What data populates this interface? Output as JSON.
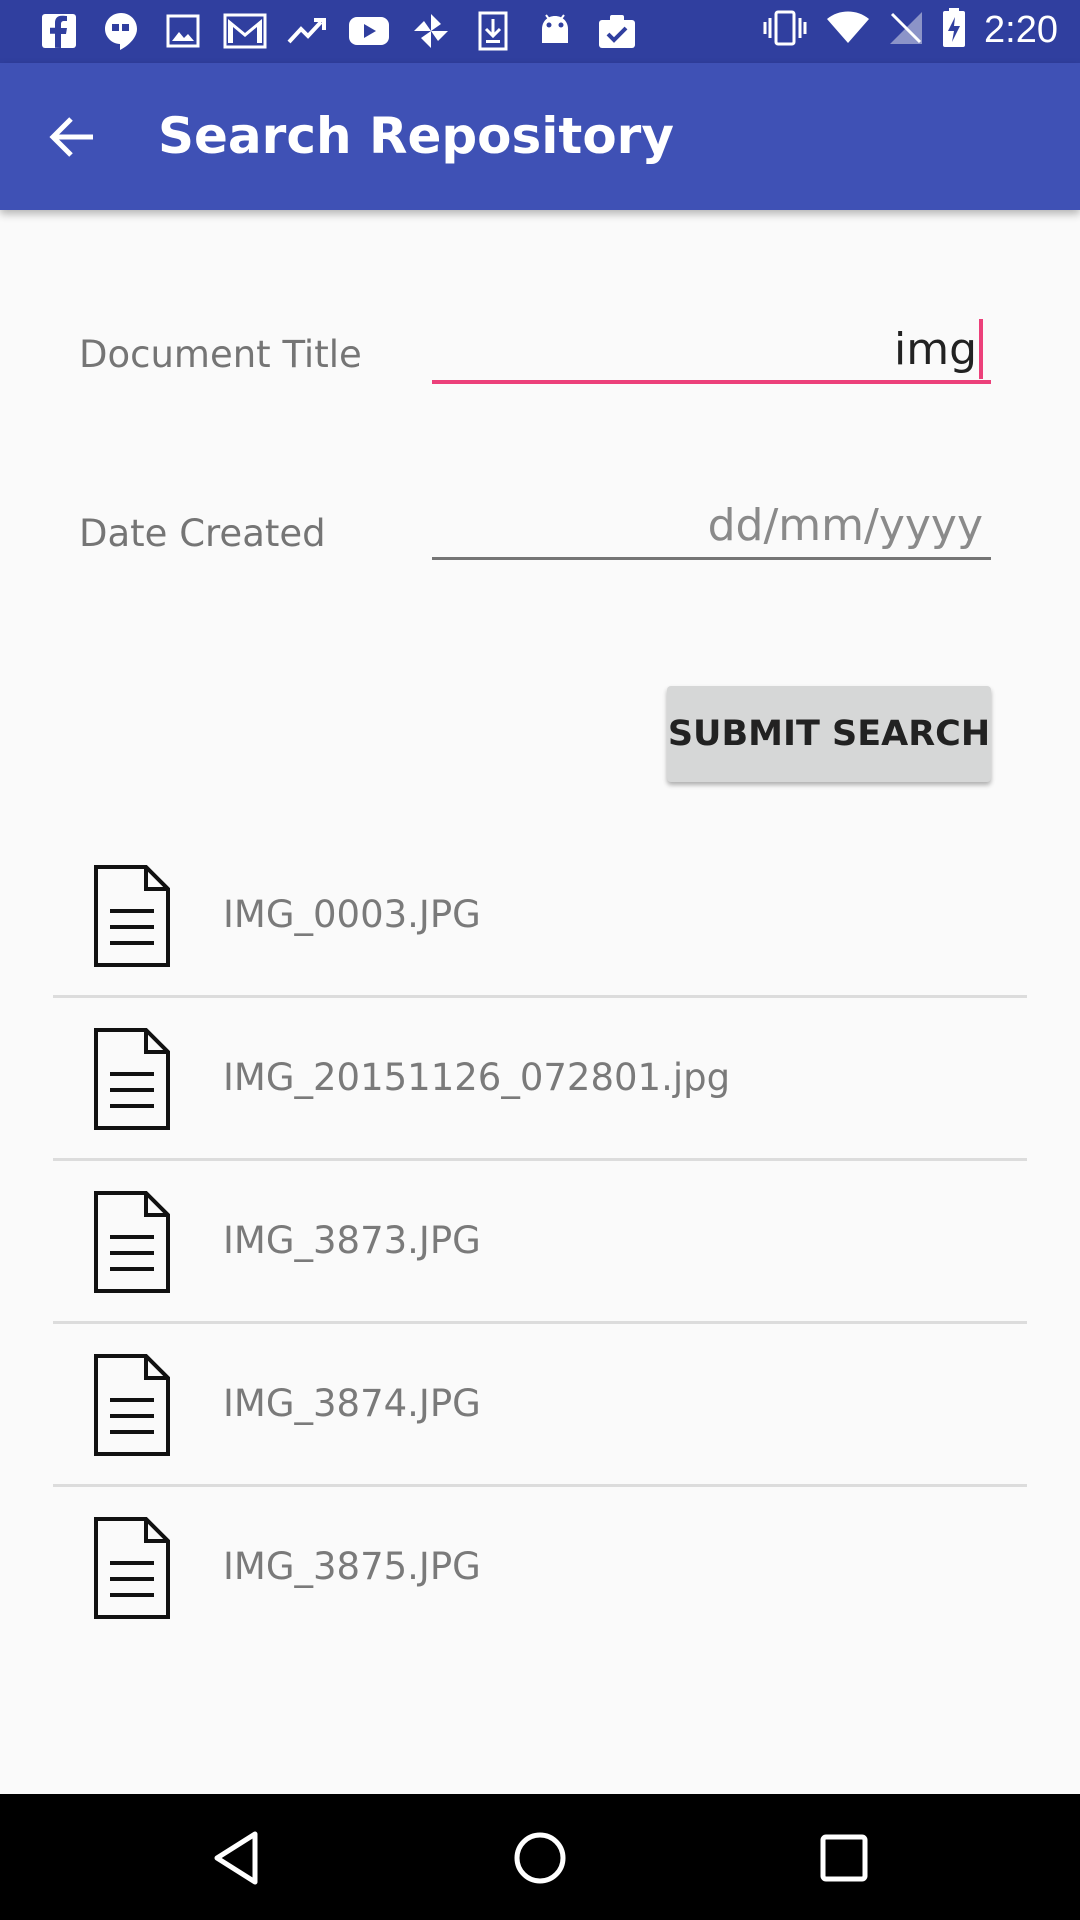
{
  "status_bar": {
    "time": "2:20",
    "left_icons": [
      "facebook-icon",
      "hangouts-icon",
      "gallery-icon",
      "gmail-icon",
      "trending-icon",
      "youtube-icon",
      "pinwheel-icon",
      "download-icon",
      "android-icon",
      "clipboard-check-icon"
    ],
    "right_icons": [
      "vibrate-icon",
      "wifi-icon",
      "no-signal-icon",
      "battery-charging-icon"
    ]
  },
  "app_bar": {
    "title": "Search Repository",
    "back_icon": "arrow-back-icon",
    "color": "#3f51b5"
  },
  "form": {
    "document_title_label": "Document Title",
    "document_title_value": "img",
    "date_created_label": "Date Created",
    "date_created_placeholder": "dd/mm/yyyy",
    "submit_label": "SUBMIT SEARCH",
    "accent_color": "#ec407a"
  },
  "results": [
    {
      "name": "IMG_0003.JPG",
      "icon": "document-icon"
    },
    {
      "name": "IMG_20151126_072801.jpg",
      "icon": "document-icon"
    },
    {
      "name": "IMG_3873.JPG",
      "icon": "document-icon"
    },
    {
      "name": "IMG_3874.JPG",
      "icon": "document-icon"
    },
    {
      "name": "IMG_3875.JPG",
      "icon": "document-icon"
    }
  ],
  "nav_bar": {
    "icons": [
      "back-triangle-icon",
      "home-circle-icon",
      "recents-square-icon"
    ]
  }
}
